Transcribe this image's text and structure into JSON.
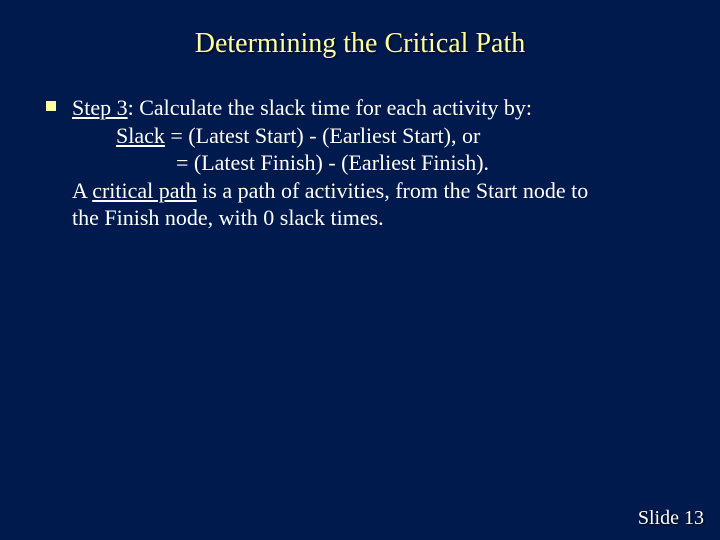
{
  "title": "Determining the Critical Path",
  "step_label": "Step 3",
  "line1_rest": ":  Calculate the slack time for each activity by:",
  "slack_label": "Slack",
  "line2_rest": " = (Latest Start) - (Earliest Start), or",
  "line3": "= (Latest Finish) - (Earliest Finish).",
  "line4_pre": "A ",
  "critical_path_label": "critical path",
  "line4_post": " is a path of activities, from the Start node to",
  "line5": "the Finish node, with 0 slack times.",
  "footer_label": "Slide",
  "footer_num": "13"
}
